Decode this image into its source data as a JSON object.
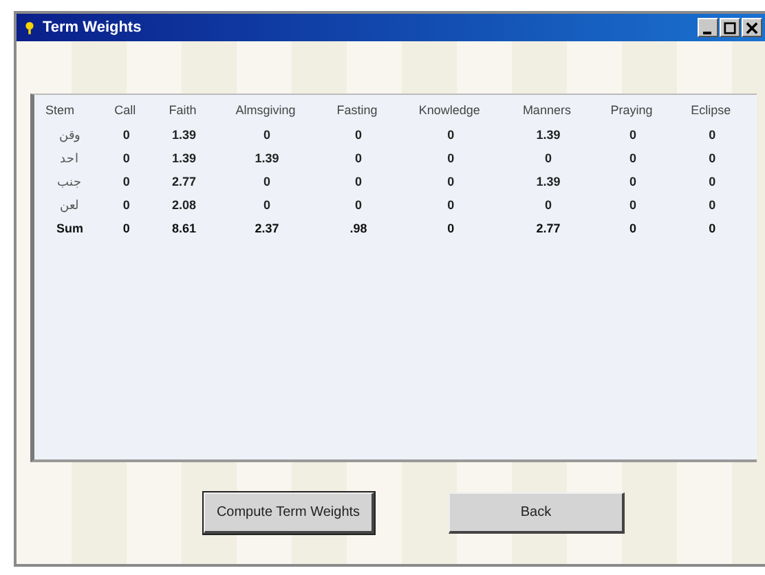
{
  "window": {
    "title": "Term Weights"
  },
  "table": {
    "columns": [
      "Stem",
      "Call",
      "Faith",
      "Almsgiving",
      "Fasting",
      "Knowledge",
      "Manners",
      "Praying",
      "Eclipse"
    ],
    "rows": [
      {
        "kind": "stem",
        "cells": [
          "وقن",
          "0",
          "1.39",
          "0",
          "0",
          "0",
          "1.39",
          "0",
          "0"
        ]
      },
      {
        "kind": "stem",
        "cells": [
          "احد",
          "0",
          "1.39",
          "1.39",
          "0",
          "0",
          "0",
          "0",
          "0"
        ]
      },
      {
        "kind": "stem",
        "cells": [
          "جنب",
          "0",
          "2.77",
          "0",
          "0",
          "0",
          "1.39",
          "0",
          "0"
        ]
      },
      {
        "kind": "stem",
        "cells": [
          "لعن",
          "0",
          "2.08",
          "0",
          "0",
          "0",
          "0",
          "0",
          "0"
        ]
      },
      {
        "kind": "sum",
        "cells": [
          "Sum",
          "0",
          "8.61",
          "2.37",
          ".98",
          "0",
          "2.77",
          "0",
          "0"
        ]
      }
    ]
  },
  "buttons": [
    "Compute Term Weights",
    "Back"
  ]
}
